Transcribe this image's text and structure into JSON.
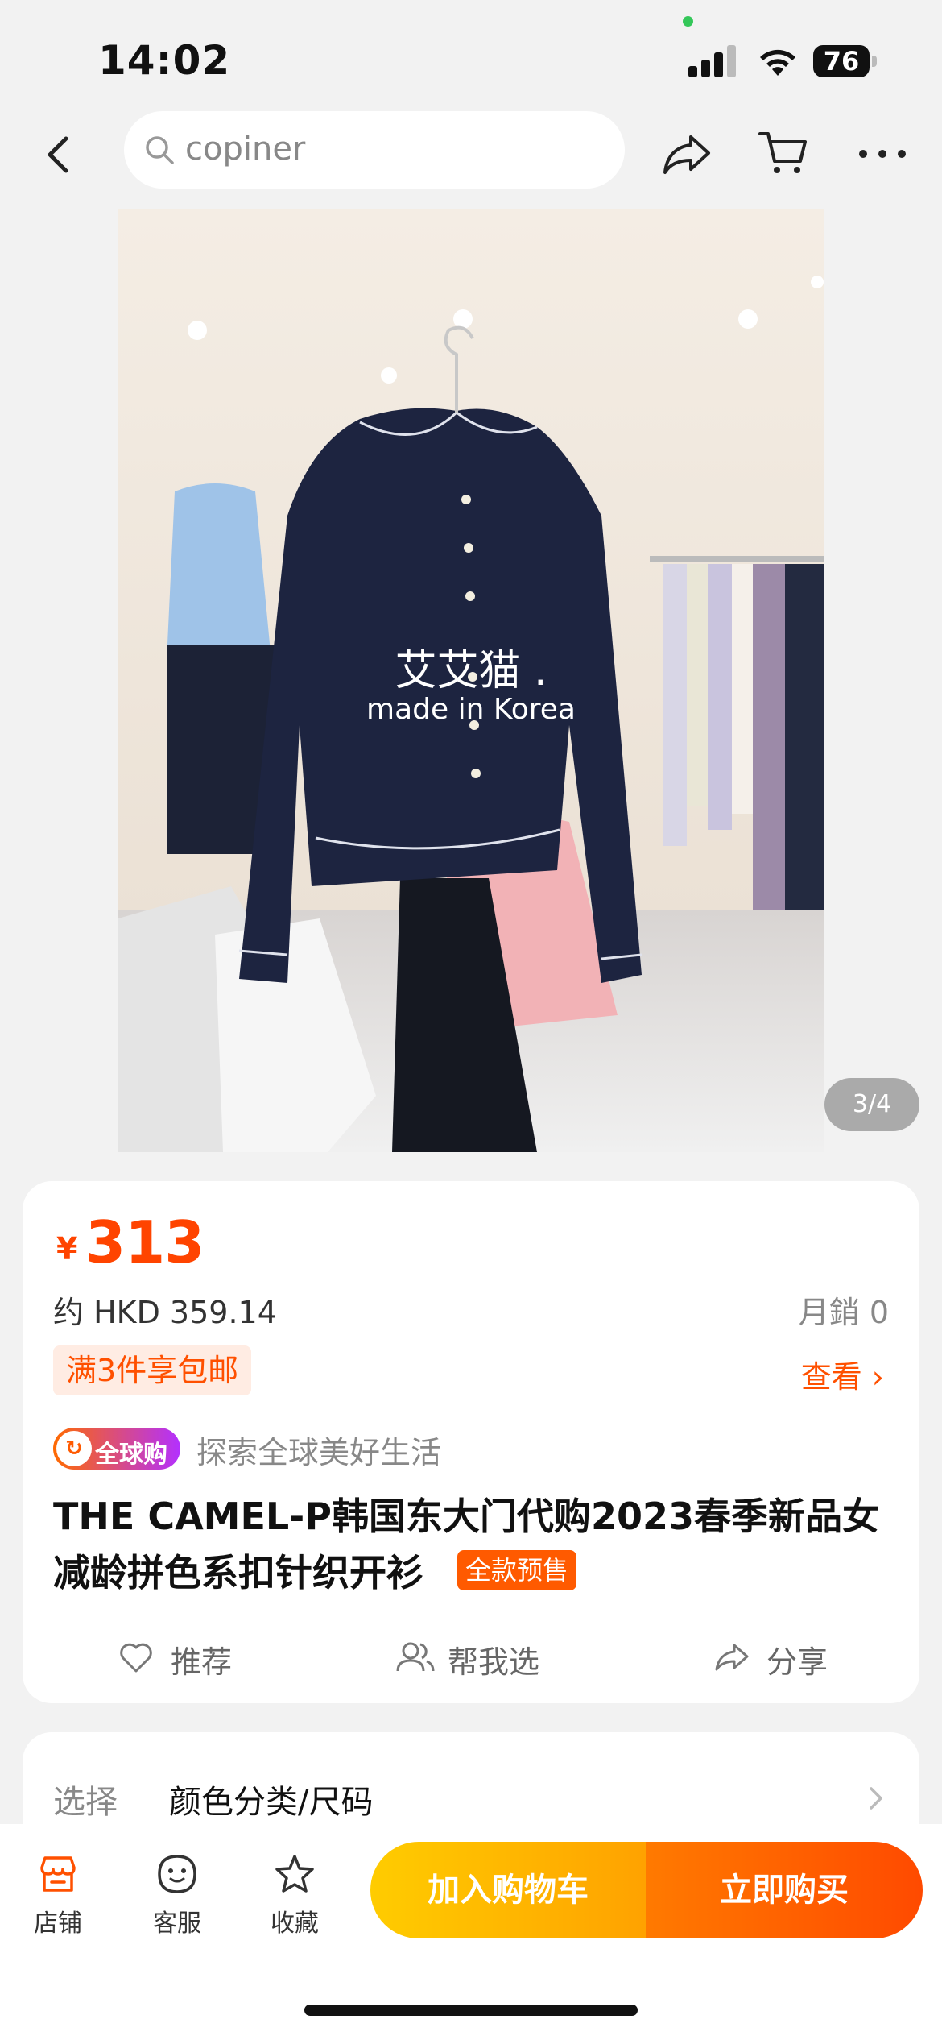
{
  "status_bar": {
    "time": "14:02",
    "battery": "76"
  },
  "search": {
    "placeholder": "copiner"
  },
  "product_image": {
    "counter": "3/4",
    "watermark_line1": "艾艾猫 .",
    "watermark_line2": "made in Korea"
  },
  "price": {
    "symbol": "¥",
    "value": "313",
    "hkd": "约 HKD 359.14",
    "monthly_sales": "月銷 0"
  },
  "promo": {
    "tag": "满3件享包邮",
    "view_label": "查看 ›"
  },
  "global": {
    "badge": "全球购",
    "badge_logo": "↻",
    "slogan": "探索全球美好生活"
  },
  "title": {
    "line1": "THE CAMEL-P韩国东大门代购2023春季新品女",
    "line2": "减龄拼色系扣针织开衫",
    "presale_tag": "全款预售"
  },
  "actions": {
    "recommend": "推荐",
    "help_choose": "帮我选",
    "share": "分享"
  },
  "select": {
    "label": "选择",
    "value": "颜色分类/尺码"
  },
  "bottom_bar": {
    "store": "店铺",
    "service": "客服",
    "favorite": "收藏",
    "add_to_cart": "加入购物车",
    "buy_now": "立即购买"
  },
  "colors": {
    "accent_orange": "#ff5000",
    "cart_button": "#ffb400",
    "buy_button": "#ff5a00"
  }
}
